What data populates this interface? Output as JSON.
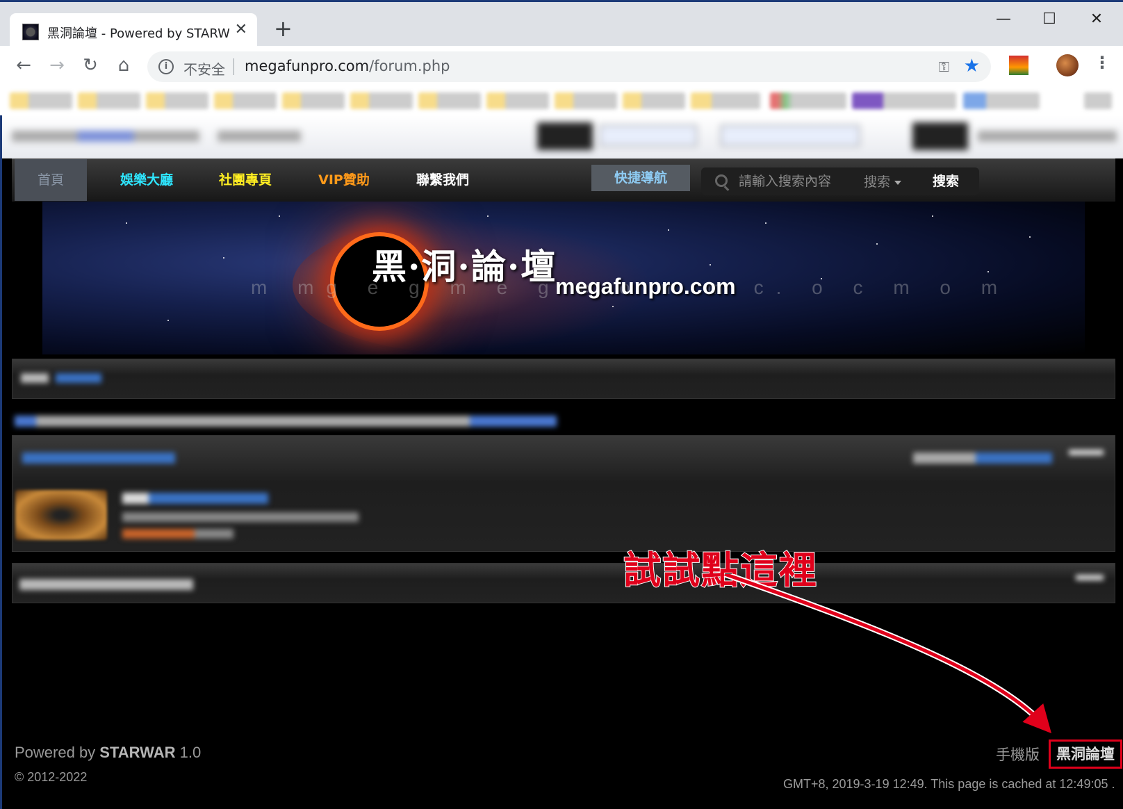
{
  "browser": {
    "tab_title": "黑洞論壇 - Powered by STARW",
    "url_insecure_label": "不安全",
    "url_host": "megafunpro.com",
    "url_path": "/forum.php"
  },
  "nav": {
    "home": "首頁",
    "entertainment": "娛樂大廳",
    "community": "社團專頁",
    "vip": "VIP贊助",
    "contact": "聯繫我們",
    "quick_nav": "快捷導航",
    "search_placeholder": "請輸入搜索內容",
    "search_type": "搜索",
    "search_button": "搜索"
  },
  "nav_colors": {
    "entertainment": "#2ee6ff",
    "community": "#ffee22",
    "vip": "#ff9a1a",
    "contact": "#ffffff"
  },
  "banner": {
    "title": "黑·洞·論·壇",
    "site": "megafunpro.com",
    "ghost": "m mg e g m e g c.o m m c. o c m o m"
  },
  "annotation": {
    "text": "試試點這裡",
    "color": "#e0001b"
  },
  "footer": {
    "powered_prefix": "Powered by ",
    "powered_brand": "STARWAR",
    "powered_version": " 1.0",
    "copyright": "© 2012-2022",
    "mobile": "手機版",
    "home_link": "黑洞論壇",
    "timestamp": "GMT+8, 2019-3-19 12:49. This page is cached at 12:49:05 ."
  }
}
